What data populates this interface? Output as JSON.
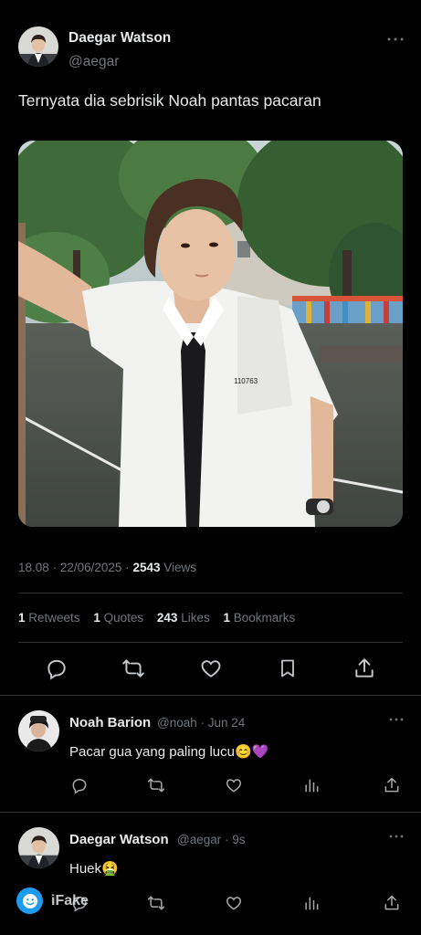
{
  "tweet": {
    "author_name": "Daegar Watson",
    "author_handle": "@aegar",
    "text": "Ternyata dia sebrisik Noah pantas pacaran",
    "time": "18.08",
    "date": "22/06/2025",
    "views_count": "2543",
    "views_label": "Views",
    "stats": {
      "retweets_count": "1",
      "retweets_label": "Retweets",
      "quotes_count": "1",
      "quotes_label": "Quotes",
      "likes_count": "243",
      "likes_label": "Likes",
      "bookmarks_count": "1",
      "bookmarks_label": "Bookmarks"
    },
    "photo_shirt_number": "110763"
  },
  "replies": [
    {
      "name": "Noah Barion",
      "handle": "@noah",
      "time": "Jun 24",
      "text": "Pacar gua yang paling lucu😊💜"
    },
    {
      "name": "Daegar Watson",
      "handle": "@aegar",
      "time": "9s",
      "text": "Huek🤮"
    }
  ],
  "separator": "·",
  "watermark": {
    "text": "iFake"
  },
  "icons": {
    "more": "more-icon",
    "reply": "reply-icon",
    "retweet": "retweet-icon",
    "like": "heart-icon",
    "bookmark": "bookmark-icon",
    "share": "share-icon",
    "views": "views-icon"
  },
  "colors": {
    "background": "#000000",
    "text_primary": "#e7e9ea",
    "text_secondary": "#71767b",
    "divider": "#2f3336",
    "watermark_badge": "#1d9bf0"
  }
}
